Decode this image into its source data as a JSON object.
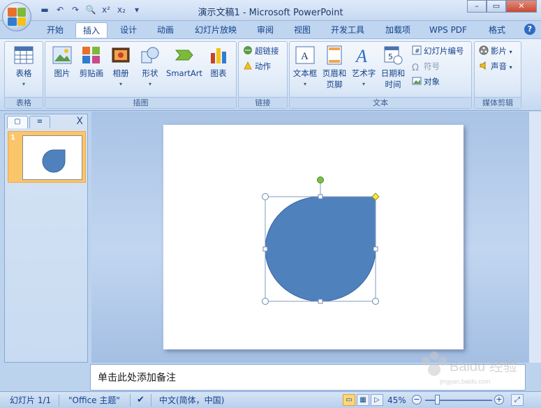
{
  "window": {
    "title": "演示文稿1 - Microsoft PowerPoint",
    "min_label": "–",
    "max_label": "▭",
    "close_label": "✕"
  },
  "quick_access": {
    "icons": [
      "save-icon",
      "undo-icon",
      "redo-icon",
      "print-preview-icon",
      "superscript-icon",
      "subscript-icon",
      "customize-qat-icon"
    ],
    "labels": [
      "▬",
      "↶",
      "↷",
      "🔍",
      "x²",
      "x₂",
      "▾"
    ]
  },
  "tabs": [
    {
      "label": "开始"
    },
    {
      "label": "插入",
      "active": true
    },
    {
      "label": "设计"
    },
    {
      "label": "动画"
    },
    {
      "label": "幻灯片放映"
    },
    {
      "label": "审阅"
    },
    {
      "label": "视图"
    },
    {
      "label": "开发工具"
    },
    {
      "label": "加载项"
    },
    {
      "label": "WPS PDF"
    },
    {
      "label": "格式"
    }
  ],
  "ribbon": {
    "groups": {
      "table": {
        "label": "表格",
        "buttons": [
          "表格"
        ]
      },
      "illustrations": {
        "label": "插图",
        "buttons": [
          "图片",
          "剪贴画",
          "相册",
          "形状",
          "SmartArt",
          "图表"
        ]
      },
      "links": {
        "label": "链接",
        "buttons": [
          "超链接",
          "动作"
        ]
      },
      "text": {
        "label": "文本",
        "buttons": [
          "文本框",
          "页眉和",
          "页脚",
          "艺术字",
          "日期和",
          "时间",
          "幻灯片编号",
          "符号",
          "对象"
        ]
      },
      "media": {
        "label": "媒体剪辑",
        "buttons": [
          "影片",
          "声音"
        ]
      }
    }
  },
  "slides_pane": {
    "close_label": "X",
    "thumbnail_number": "1"
  },
  "notes": {
    "placeholder": "单击此处添加备注"
  },
  "status_bar": {
    "slide_info": "幻灯片 1/1",
    "theme": "\"Office 主题\"",
    "language": "中文(简体，中国)",
    "zoom": "45%",
    "zoom_out": "−",
    "zoom_in": "+"
  },
  "watermark": {
    "text": "Baidu 经验",
    "sub": "jingyan.baidu.com"
  },
  "colors": {
    "shape_fill": "#4f81bd",
    "shape_stroke": "#3a64a0",
    "selection_handle": "#ffffff",
    "rotate_handle": "#7cc04a",
    "adjust_handle": "#f5e642",
    "thumbnail_highlight": "#fbc66b"
  }
}
